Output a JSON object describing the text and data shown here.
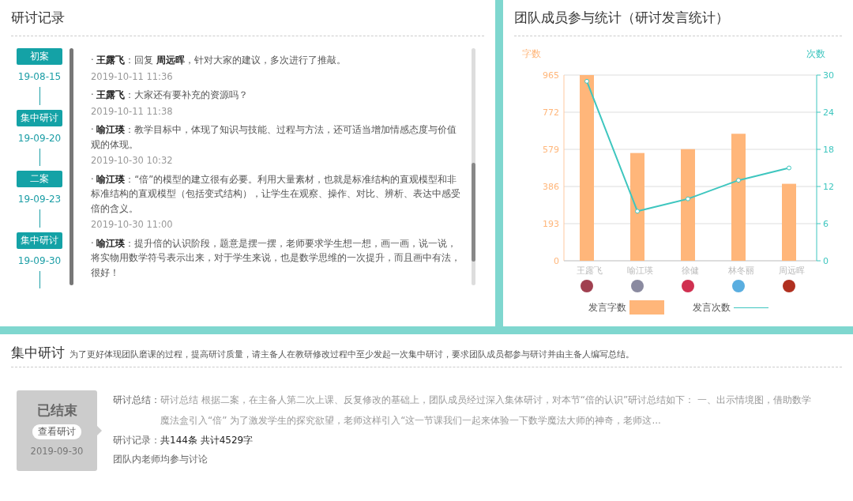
{
  "discussion_log": {
    "title": "研讨记录",
    "timeline": [
      {
        "label": "初案",
        "date": "19-08-15"
      },
      {
        "label": "集中研讨",
        "date": "19-09-20"
      },
      {
        "label": "二案",
        "date": "19-09-23"
      },
      {
        "label": "集中研讨",
        "date": "19-09-30"
      }
    ],
    "messages": [
      {
        "text": "· **王露飞**：回复 **周远晖**，针对大家的建议，多次进行了推敲。",
        "time": "2019-10-11 11:36"
      },
      {
        "text": "· **王露飞**：大家还有要补充的资源吗？",
        "time": "2019-10-11 11:38"
      },
      {
        "text": "· **喻江瑛**：教学目标中，体现了知识与技能、过程与方法，还可适当增加情感态度与价值观的体现。",
        "time": "2019-10-30 10:32"
      },
      {
        "text": "· **喻江瑛**：“倍”的模型的建立很有必要。利用大量素材，也就是标准结构的直观模型和非标准结构的直观模型（包括变式结构），让学生在观察、操作、对比、辨析、表达中感受倍的含义。",
        "time": "2019-10-30 11:00"
      },
      {
        "text": "· **喻江瑛**：提升倍的认识阶段，题意是摆一摆，老师要求学生想一想，画一画，说一说，将实物用数学符号表示出来，对于学生来说，也是数学思维的一次提升，而且画中有法，很好！"
      }
    ]
  },
  "team_stats": {
    "title": "团队成员参与统计（研讨发言统计）",
    "chart_data": {
      "type": "bar",
      "ylabel": "字数",
      "y2label": "次数",
      "categories": [
        "王露飞",
        "喻江瑛",
        "徐健",
        "林冬丽",
        "周远晖"
      ],
      "ylim": [
        0,
        965
      ],
      "yticks": [
        0,
        193,
        386,
        579,
        772,
        965
      ],
      "y2lim": [
        0,
        30
      ],
      "y2ticks": [
        0,
        6,
        12,
        18,
        24,
        30
      ],
      "stacked": false,
      "grid": true,
      "series": [
        {
          "name": "发言字数",
          "type": "bar",
          "color": "#ffb67a",
          "values": [
            965,
            560,
            580,
            660,
            400
          ]
        },
        {
          "name": "发言次数",
          "type": "line",
          "axis": "y2",
          "marker": "circle",
          "color": "#3ec6bf",
          "values": [
            29,
            8,
            10,
            13,
            15
          ]
        }
      ]
    }
  },
  "focused_discussion": {
    "title": "集中研讨",
    "description": "为了更好体现团队磨课的过程，提高研讨质量，请主备人在教研修改过程中至少发起一次集中研讨，要求团队成员都参与研讨并由主备人编写总结。",
    "status": "已结束",
    "view_button": "查看研讨",
    "date": "2019-09-30",
    "summary_label": "研讨总结：",
    "summary": "研讨总结 根据二案，在主备人第二次上课、反复修改的基础上，团队成员经过深入集体研讨，对本节“倍的认识”研讨总结如下： 一、出示情境图，借助数学魔法盒引入“倍” 为了激发学生的探究欲望，老师这样引入“这一节课我们一起来体验一下数学魔法大师的神奇，老师这...",
    "records_label": "研讨记录：",
    "records": "共144条 共计4529字",
    "note": "团队内老师均参与讨论"
  }
}
